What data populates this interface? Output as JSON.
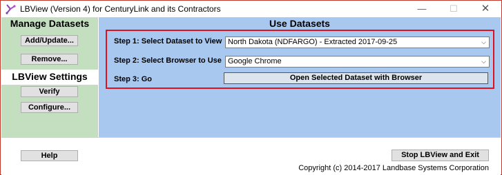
{
  "window": {
    "title": "LBView (Version 4) for CenturyLink and its Contractors",
    "minimize": "—",
    "maximize": "☐",
    "close": "✕"
  },
  "left": {
    "manage_title": "Manage Datasets",
    "add_update_label": "Add/Update...",
    "remove_label": "Remove...",
    "settings_title": "LBView Settings",
    "verify_label": "Verify",
    "configure_label": "Configure..."
  },
  "main": {
    "title": "Use Datasets",
    "step1_label": "Step 1: Select Dataset to View",
    "step1_value": "North Dakota (NDFARGO) - Extracted 2017-09-25",
    "step2_label": "Step 2: Select Browser to Use",
    "step2_value": "Google Chrome",
    "step3_label": "Step 3: Go",
    "open_button_label": "Open Selected Dataset with Browser"
  },
  "bottom": {
    "help_label": "Help",
    "exit_label": "Stop LBView and Exit",
    "copyright": "Copyright (c) 2014-2017 Landbase Systems Corporation"
  },
  "colors": {
    "left_panel_bg": "#c3dfc0",
    "right_panel_bg": "#a8c8f0",
    "highlight_border": "#e0101e"
  },
  "icons": {
    "app": "app-logo-icon",
    "dropdown": "chevron-down-icon"
  }
}
